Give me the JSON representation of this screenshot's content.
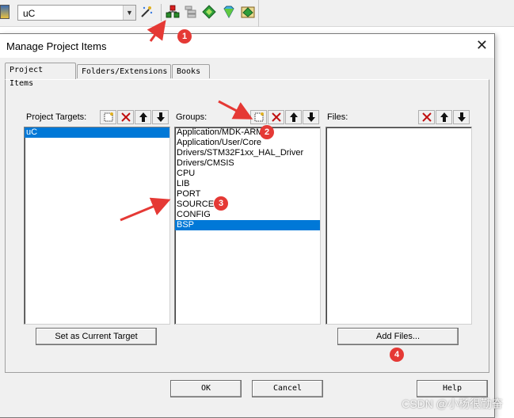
{
  "toolbar": {
    "target_value": "uC",
    "icons": [
      "project-load-icon",
      "target-options-icon",
      "manage-project-items-icon",
      "select-packs-icon",
      "pack-installer-icon",
      "software-components-icon",
      "manage-runtime-env-icon"
    ]
  },
  "dialog": {
    "title": "Manage Project Items",
    "close_glyph": "✕",
    "tabs": [
      {
        "label": "Project Items",
        "active": true
      },
      {
        "label": "Folders/Extensions",
        "active": false
      },
      {
        "label": "Books",
        "active": false
      }
    ],
    "targets": {
      "label": "Project Targets:",
      "items": [
        {
          "text": "uC",
          "selected": true
        }
      ],
      "set_current_label": "Set as Current Target"
    },
    "groups": {
      "label": "Groups:",
      "items": [
        {
          "text": "Application/MDK-ARM",
          "selected": false
        },
        {
          "text": "Application/User/Core",
          "selected": false
        },
        {
          "text": "Drivers/STM32F1xx_HAL_Driver",
          "selected": false
        },
        {
          "text": "Drivers/CMSIS",
          "selected": false
        },
        {
          "text": "CPU",
          "selected": false
        },
        {
          "text": "LIB",
          "selected": false
        },
        {
          "text": "PORT",
          "selected": false
        },
        {
          "text": "SOURCE",
          "selected": false
        },
        {
          "text": "CONFIG",
          "selected": false
        },
        {
          "text": "BSP",
          "selected": true
        }
      ]
    },
    "files": {
      "label": "Files:",
      "items": [],
      "add_files_label": "Add Files..."
    },
    "buttons": {
      "ok": "OK",
      "cancel": "Cancel",
      "help": "Help"
    }
  },
  "annotations": {
    "badges": [
      "1",
      "2",
      "3",
      "4"
    ],
    "color": "#e53935"
  },
  "watermark": "CSDN @小杨很勤奋",
  "colors": {
    "selection": "#0078d7",
    "dialog_bg": "#f0f0f0",
    "annotation": "#e53935"
  }
}
